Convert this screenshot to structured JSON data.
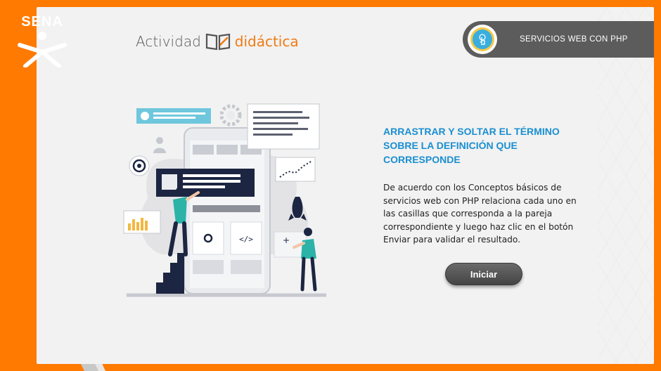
{
  "logo": {
    "text": "SENA"
  },
  "brand": {
    "part1": "Actividad",
    "part2": "didáctica"
  },
  "topic": {
    "label": "SERVICIOS WEB CON PHP",
    "icon": "touch-icon"
  },
  "main": {
    "title": "ARRASTRAR Y SOLTAR EL TÉRMINO SOBRE LA DEFINICIÓN QUE CORRESPONDE",
    "description": "De acuerdo con los Conceptos básicos de servicios web con PHP relaciona cada uno en las casillas que corresponda a la pareja correspondiente y luego haz clic en el botón Enviar para validar el resultado.",
    "button_label": "Iniciar"
  },
  "illustration": {
    "code_symbol": "</>",
    "plus_symbol": "+"
  },
  "colors": {
    "brand_orange": "#ff7a00",
    "title_blue": "#1a8fd0",
    "badge_gray": "#5c5c5c"
  }
}
